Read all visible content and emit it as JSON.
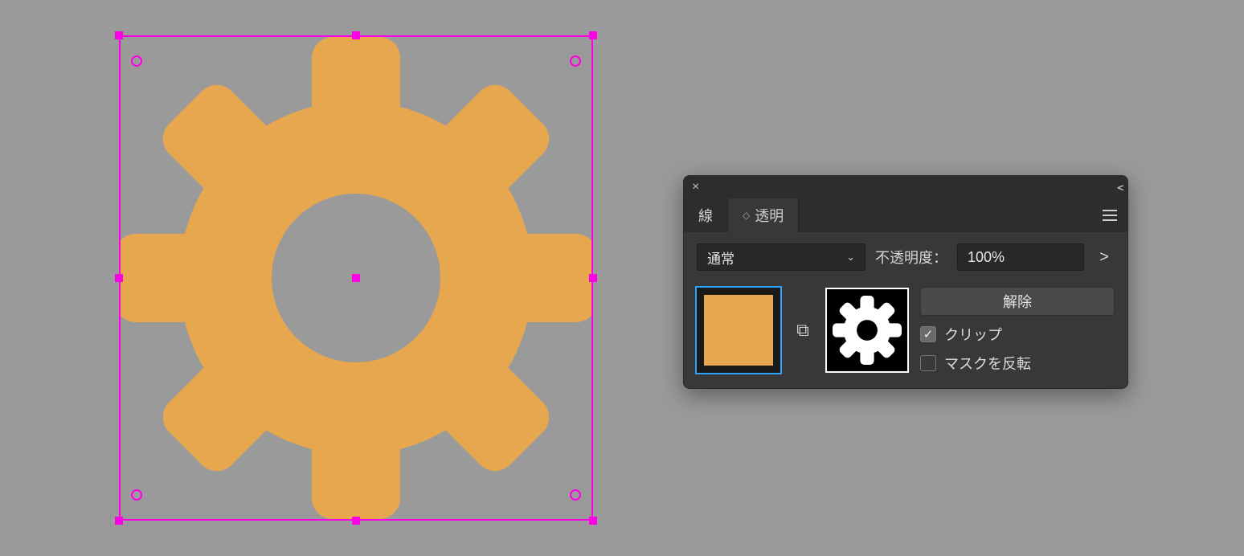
{
  "colors": {
    "gear_fill": "#e7a74f",
    "selection": "#ff00e6"
  },
  "panel": {
    "tabs": {
      "stroke": "線",
      "transparency": "透明"
    },
    "blend_mode": "通常",
    "opacity_label": "不透明度：",
    "opacity_value": "100%",
    "release_label": "解除",
    "clip_label": "クリップ",
    "invert_label": "マスクを反転",
    "clip_checked": true,
    "invert_checked": false
  }
}
